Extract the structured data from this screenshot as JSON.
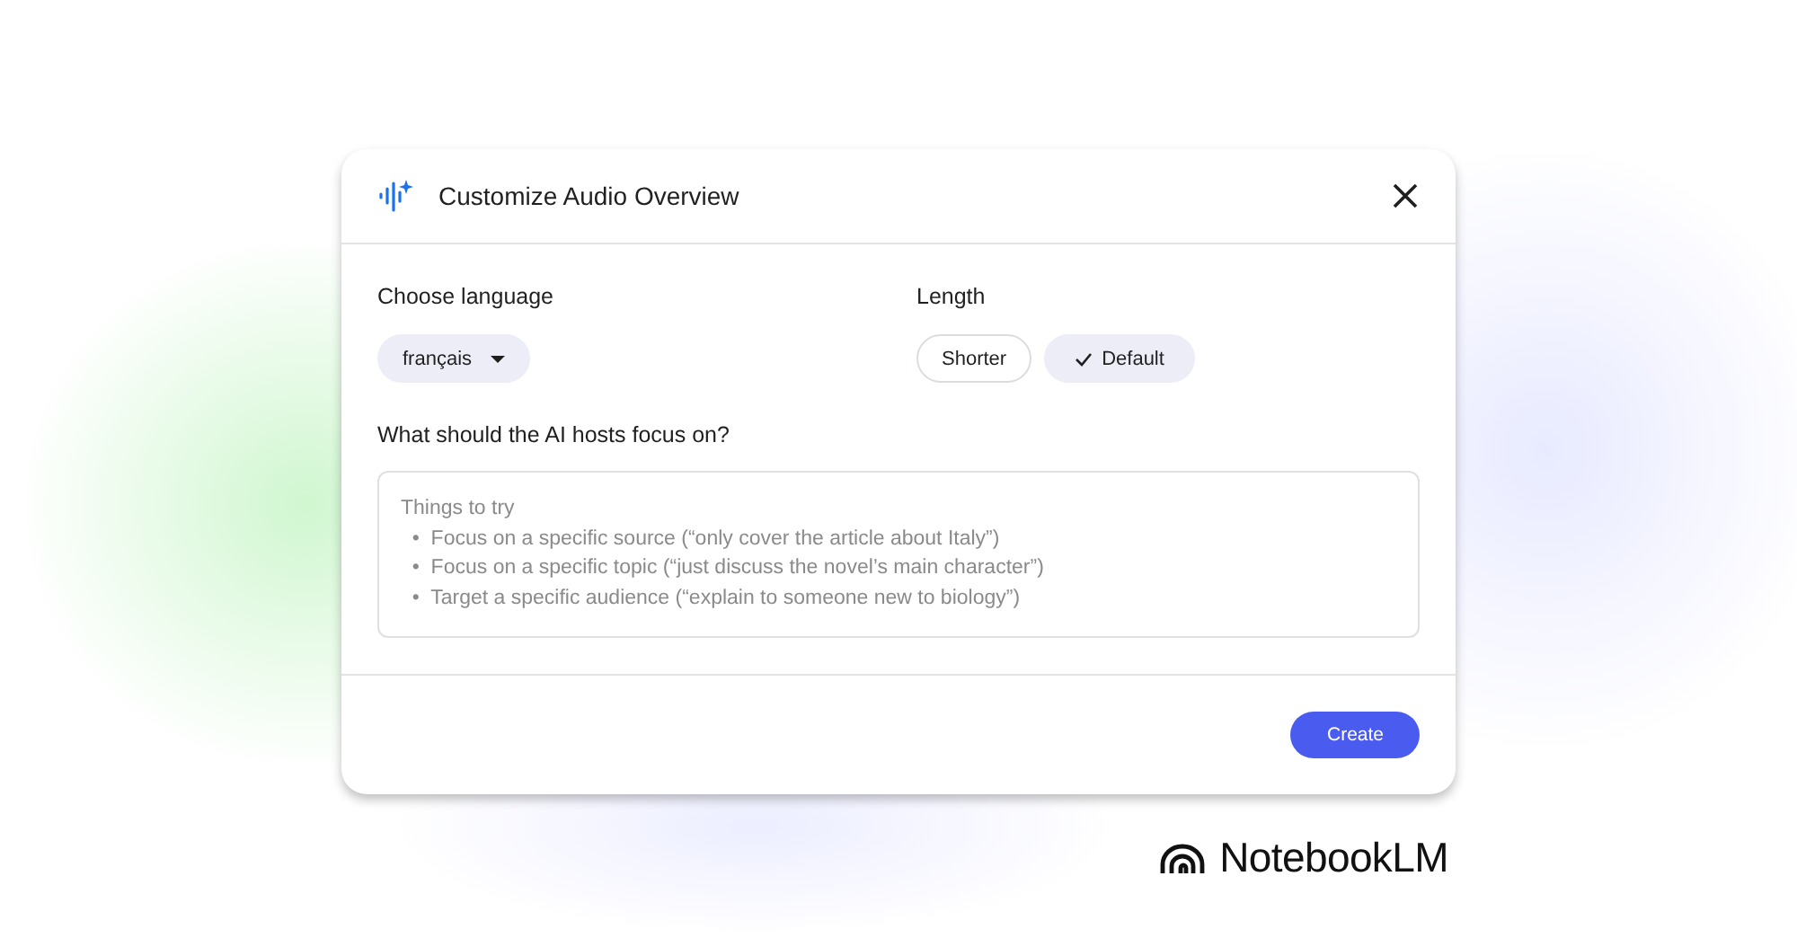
{
  "dialog": {
    "title": "Customize Audio Overview",
    "language": {
      "label": "Choose language",
      "value": "français"
    },
    "length": {
      "label": "Length",
      "options": [
        {
          "label": "Shorter",
          "selected": false
        },
        {
          "label": "Default",
          "selected": true
        }
      ]
    },
    "focus": {
      "label": "What should the AI hosts focus on?",
      "placeholder": "Things to try\n  •  Focus on a specific source (“only cover the article about Italy”)\n  •  Focus on a specific topic (“just discuss the novel’s main character”)\n  •  Target a specific audience (“explain to someone new to biology”)"
    },
    "buttons": [
      "Create"
    ]
  },
  "brand": {
    "name": "NotebookLM"
  }
}
